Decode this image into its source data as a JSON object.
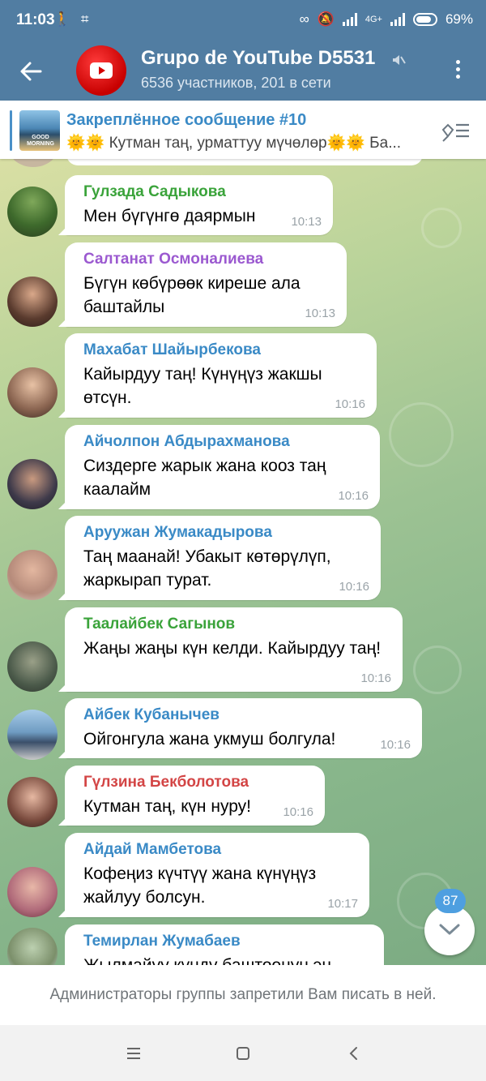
{
  "status_bar": {
    "time": "11:03",
    "network": "4G+",
    "battery": "69%"
  },
  "header": {
    "title": "Grupo de YouTube D5531",
    "subtitle": "6536 участников, 201 в сети"
  },
  "pinned": {
    "title": "Закреплённое сообщение #10",
    "text": "🌞🌞 Кутман таң, урматтуу мүчөлөр🌞🌞 Ба...",
    "thumb_text": "GOOD MORNING"
  },
  "messages": [
    {
      "sender": "Гулзада Садыкова",
      "color": "#3aa33a",
      "text": "Мен бүгүнгө даярмын",
      "time": "10:13"
    },
    {
      "sender": "Салтанат Осмоналиева",
      "color": "#9b59d0",
      "text": "Бүгүн көбүрөөк киреше ала баштайлы",
      "time": "10:13"
    },
    {
      "sender": "Махабат Шайырбекова",
      "color": "#3a8ac6",
      "text": "Кайырдуу таң! Күнүңүз жакшы өтсүн.",
      "time": "10:16"
    },
    {
      "sender": "Айчолпон Абдырахманова",
      "color": "#3a8ac6",
      "text": "Сиздерге жарык жана кооз таң каалайм",
      "time": "10:16"
    },
    {
      "sender": "Аруужан Жумакадырова",
      "color": "#3a8ac6",
      "text": "Таң маанай! Убакыт көтөрүлүп, жаркырап турат.",
      "time": "10:16"
    },
    {
      "sender": "Таалайбек Сагынов",
      "color": "#3aa33a",
      "text": "Жаңы жаңы күн келди. Кайырдуу таң!",
      "time": "10:16"
    },
    {
      "sender": "Айбек Кубанычев",
      "color": "#3a8ac6",
      "text": "Ойгонгула жана укмуш болгула!",
      "time": "10:16"
    },
    {
      "sender": "Гүлзина Бекболотова",
      "color": "#d34545",
      "text": "Кутман таң, күн нуру!",
      "time": "10:16"
    },
    {
      "sender": "Айдай Мамбетова",
      "color": "#3a8ac6",
      "text": "Кофеңиз күчтүү жана күнүңүз жайлуу болсун.",
      "time": "10:17"
    },
    {
      "sender": "Темирлан Жумабаев",
      "color": "#3a8ac6",
      "text": "Жылмайуу күндү баштоонун эң",
      "time": ""
    }
  ],
  "unread_count": "87",
  "restriction_notice": "Администраторы группы запретили Вам писать в ней."
}
